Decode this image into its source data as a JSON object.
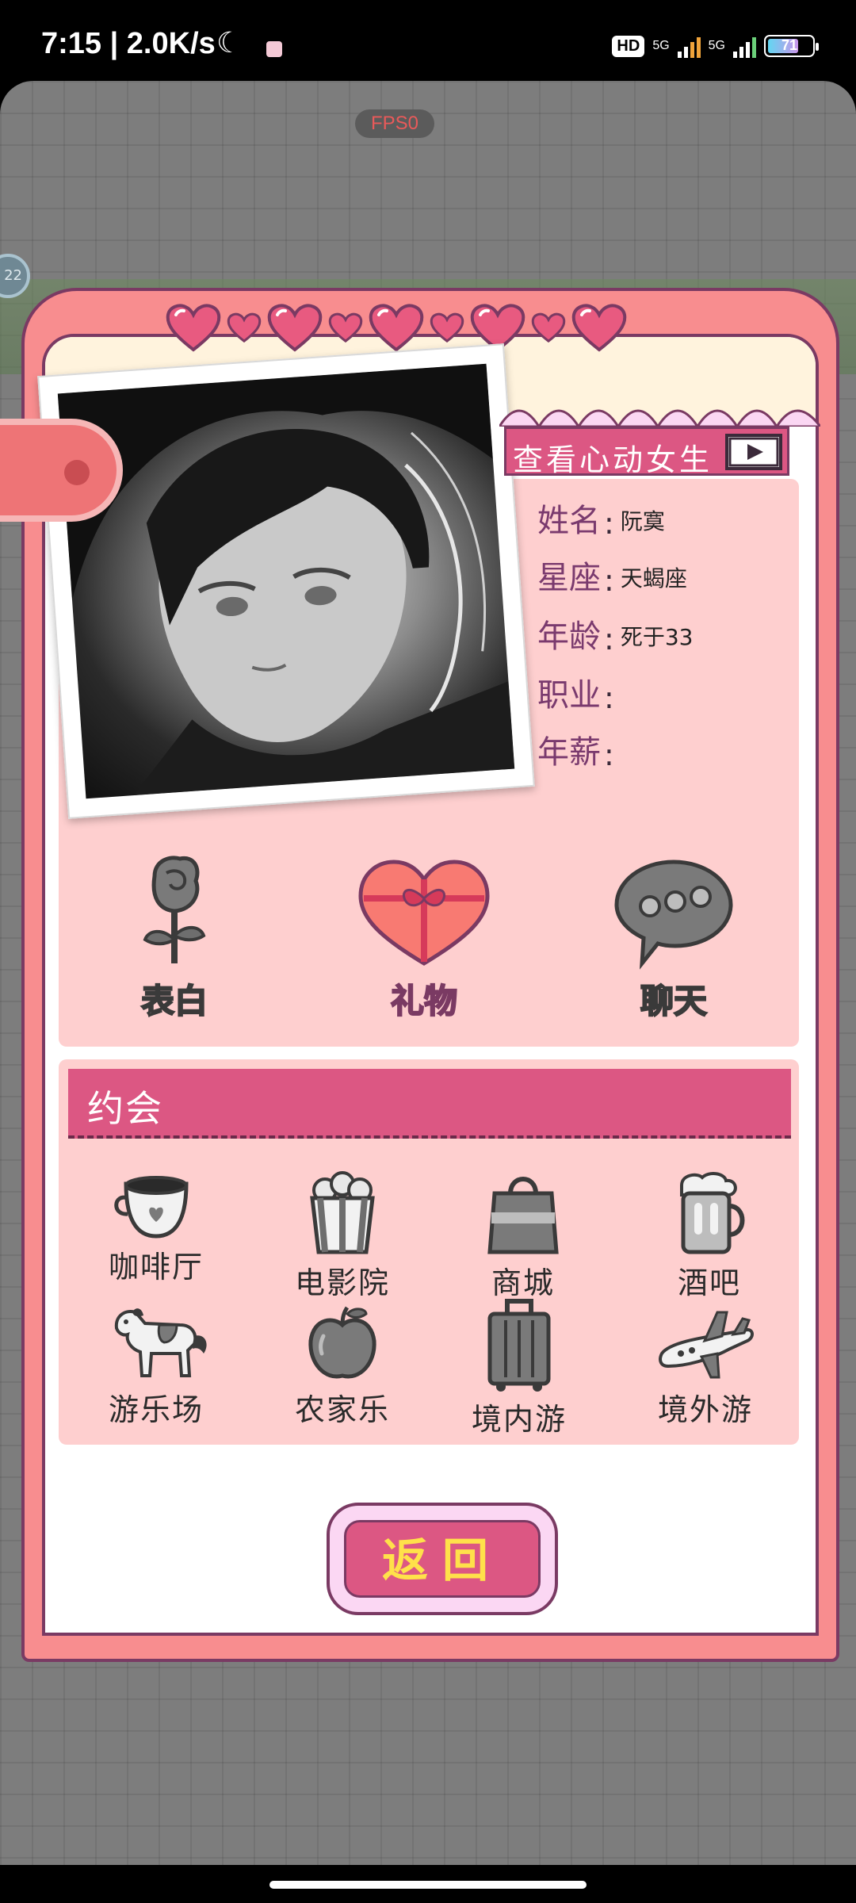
{
  "status_bar": {
    "time_speed": "7:15 | 2.0K/s",
    "hd_label": "HD",
    "network_1": "5G",
    "network_2": "5G",
    "battery": "71"
  },
  "game": {
    "fps_label": "FPS0",
    "bg_badge": "22"
  },
  "info_panel": {
    "header": "查看心动女生",
    "fields": [
      {
        "label": "姓名",
        "value": "阮寞"
      },
      {
        "label": "星座",
        "value": "天蝎座"
      },
      {
        "label": "年龄",
        "value": "死于33"
      },
      {
        "label": "职业",
        "value": ""
      },
      {
        "label": "年薪",
        "value": ""
      }
    ]
  },
  "actions": [
    {
      "label": "表白",
      "icon": "rose-icon",
      "active": false
    },
    {
      "label": "礼物",
      "icon": "gift-heart-icon",
      "active": true
    },
    {
      "label": "聊天",
      "icon": "chat-bubble-icon",
      "active": false
    }
  ],
  "date_section": {
    "header": "约会",
    "places": [
      {
        "label": "咖啡厅",
        "icon": "coffee-cup-icon"
      },
      {
        "label": "电影院",
        "icon": "popcorn-icon"
      },
      {
        "label": "商城",
        "icon": "shopping-bag-icon"
      },
      {
        "label": "酒吧",
        "icon": "beer-mug-icon"
      },
      {
        "label": "游乐场",
        "icon": "carousel-horse-icon"
      },
      {
        "label": "农家乐",
        "icon": "apple-icon"
      },
      {
        "label": "境内游",
        "icon": "suitcase-icon"
      },
      {
        "label": "境外游",
        "icon": "airplane-icon"
      }
    ]
  },
  "back_button": "返回",
  "colors": {
    "accent_pink": "#dc5783",
    "panel_pink": "#fecfcf",
    "frame_coral": "#f88d8f",
    "outline_purple": "#7a3a63",
    "button_yellow": "#ffe14a"
  }
}
